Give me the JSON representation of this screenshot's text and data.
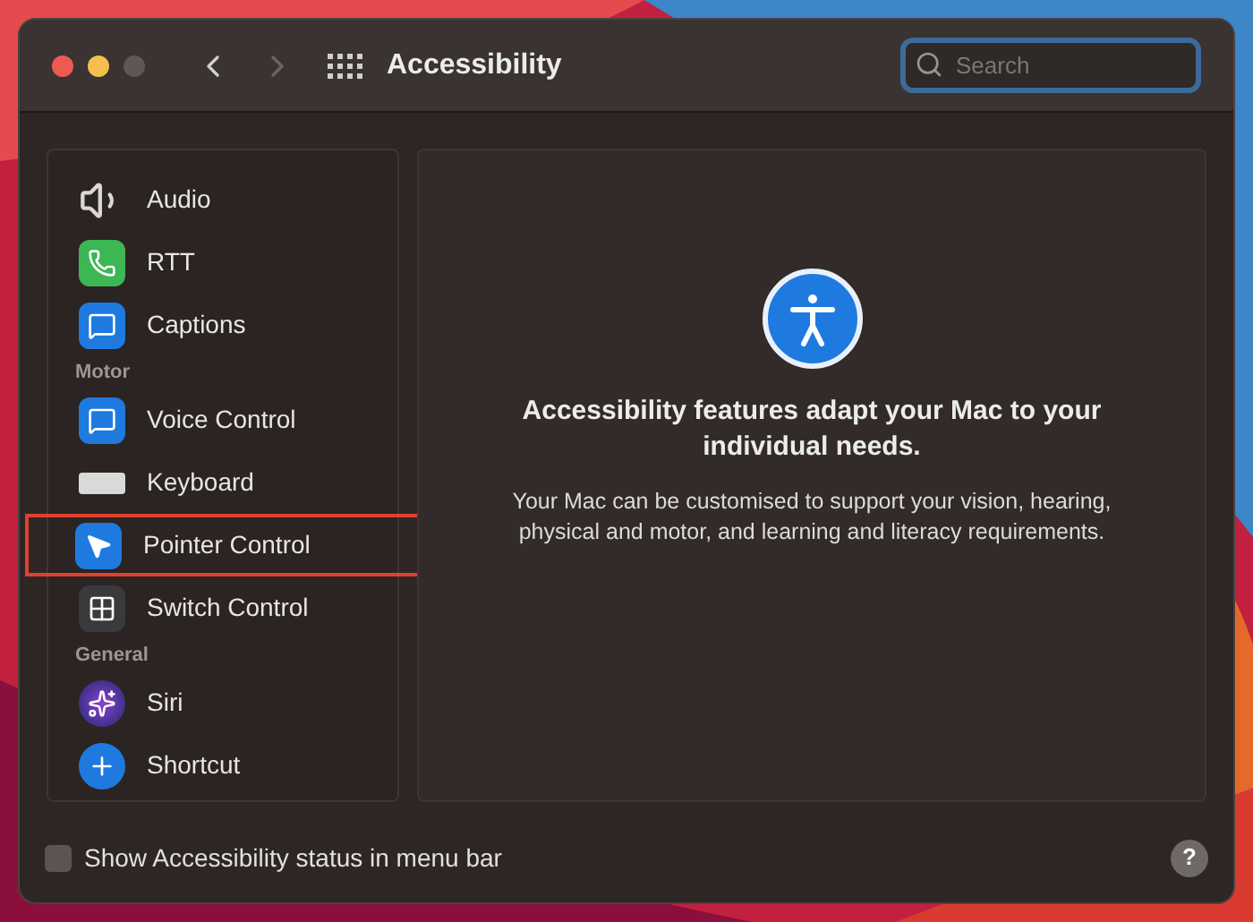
{
  "window": {
    "title": "Accessibility"
  },
  "search": {
    "placeholder": "Search"
  },
  "sidebar": {
    "items": [
      {
        "kind": "item",
        "label": "Audio",
        "highlighted": false
      },
      {
        "kind": "item",
        "label": "RTT",
        "highlighted": false
      },
      {
        "kind": "item",
        "label": "Captions",
        "highlighted": false
      },
      {
        "kind": "section",
        "label": "Motor"
      },
      {
        "kind": "item",
        "label": "Voice Control",
        "highlighted": false
      },
      {
        "kind": "item",
        "label": "Keyboard",
        "highlighted": false
      },
      {
        "kind": "item",
        "label": "Pointer Control",
        "highlighted": true
      },
      {
        "kind": "item",
        "label": "Switch Control",
        "highlighted": false
      },
      {
        "kind": "section",
        "label": "General"
      },
      {
        "kind": "item",
        "label": "Siri",
        "highlighted": false
      },
      {
        "kind": "item",
        "label": "Shortcut",
        "highlighted": false
      }
    ]
  },
  "content": {
    "heading": "Accessibility features adapt your Mac to your individual needs.",
    "description": "Your Mac can be customised to support your vision, hearing, physical and motor, and learning and literacy requirements."
  },
  "footer": {
    "checkbox": {
      "label": "Show Accessibility status in menu bar",
      "checked": false
    },
    "help": "?"
  }
}
